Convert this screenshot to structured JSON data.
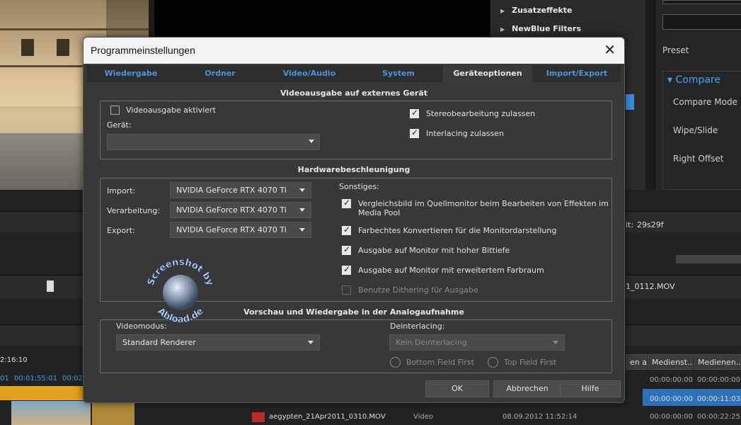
{
  "background": {
    "tree_items": [
      "Zusatzeffekte",
      "NewBlue Filters"
    ],
    "preset_label": "Preset",
    "compare": {
      "title": "Compare",
      "items": [
        "Compare Mode",
        "Wipe/Slide",
        "Right Offset"
      ]
    },
    "timecode_left": "2:16:10",
    "ruler_times": [
      "01",
      "00:01:55:01",
      "00:02"
    ],
    "length_text": "it:",
    "length_value": "29s29f",
    "file_partial": "1_0112.MOV",
    "header_buttons": [
      "en am",
      "Medienst...",
      "Medienen..."
    ],
    "file_rows": [
      {
        "name": "",
        "type": "",
        "date": "",
        "t1": "00:00:00:00",
        "t2": "00:00:00:00"
      },
      {
        "name": "",
        "type": "",
        "date": "",
        "t1": "00:00:00:00",
        "t2": "00:00:11:03"
      },
      {
        "name": "aegypten_21Apr2011_0310.MOV",
        "type": "Video",
        "date": "08.09.2012 11:52:14",
        "t1": "00:00:00:00",
        "t2": "00:00:22:25"
      }
    ]
  },
  "dialog": {
    "title": "Programmeinstellungen",
    "tabs": [
      "Wiedergabe",
      "Ordner",
      "Video/Audio",
      "System",
      "Geräteoptionen",
      "Import/Export"
    ],
    "active_tab": "Geräteoptionen",
    "section_external": {
      "title": "Videoausgabe auf externes Gerät",
      "video_output_enabled": {
        "label": "Videoausgabe aktiviert",
        "checked": false
      },
      "device_label": "Gerät:",
      "device_value": "",
      "stereo": {
        "label": "Stereobearbeitung zulassen",
        "checked": true
      },
      "interlacing": {
        "label": "Interlacing zulassen",
        "checked": true
      }
    },
    "section_hw": {
      "title": "Hardwarebeschleunigung",
      "import_label": "Import:",
      "import_value": "NVIDIA GeForce RTX 4070 Ti",
      "processing_label": "Verarbeitung:",
      "processing_value": "NVIDIA GeForce RTX 4070 Ti",
      "export_label": "Export:",
      "export_value": "NVIDIA GeForce RTX 4070 Ti",
      "misc_label": "Sonstiges:",
      "misc_options": [
        {
          "label": "Vergleichsbild im Quellmonitor beim Bearbeiten von Effekten im",
          "label2": "Media Pool",
          "checked": true,
          "disabled": false
        },
        {
          "label": "Farbechtes Konvertieren für die Monitordarstellung",
          "checked": true,
          "disabled": false
        },
        {
          "label": "Ausgabe auf Monitor mit hoher Bittiefe",
          "checked": true,
          "disabled": false
        },
        {
          "label": "Ausgabe auf Monitor mit erweitertem Farbraum",
          "checked": true,
          "disabled": false
        },
        {
          "label": "Benutze Dithering für Ausgabe",
          "checked": false,
          "disabled": true
        }
      ]
    },
    "section_preview": {
      "title": "Vorschau und Wiedergabe in der Analogaufnahme",
      "video_mode_label": "Videomodus:",
      "video_mode_value": "Standard Renderer",
      "deinterlacing_label": "Deinterlacing:",
      "deinterlacing_value": "Kein Deinterlacing",
      "bottom_field": "Bottom Field First",
      "top_field": "Top Field First"
    },
    "buttons": {
      "ok": "OK",
      "cancel": "Abbrechen",
      "help": "Hilfe"
    },
    "watermark": {
      "line1": "Screenshot by",
      "line2": "Abload.de"
    }
  }
}
